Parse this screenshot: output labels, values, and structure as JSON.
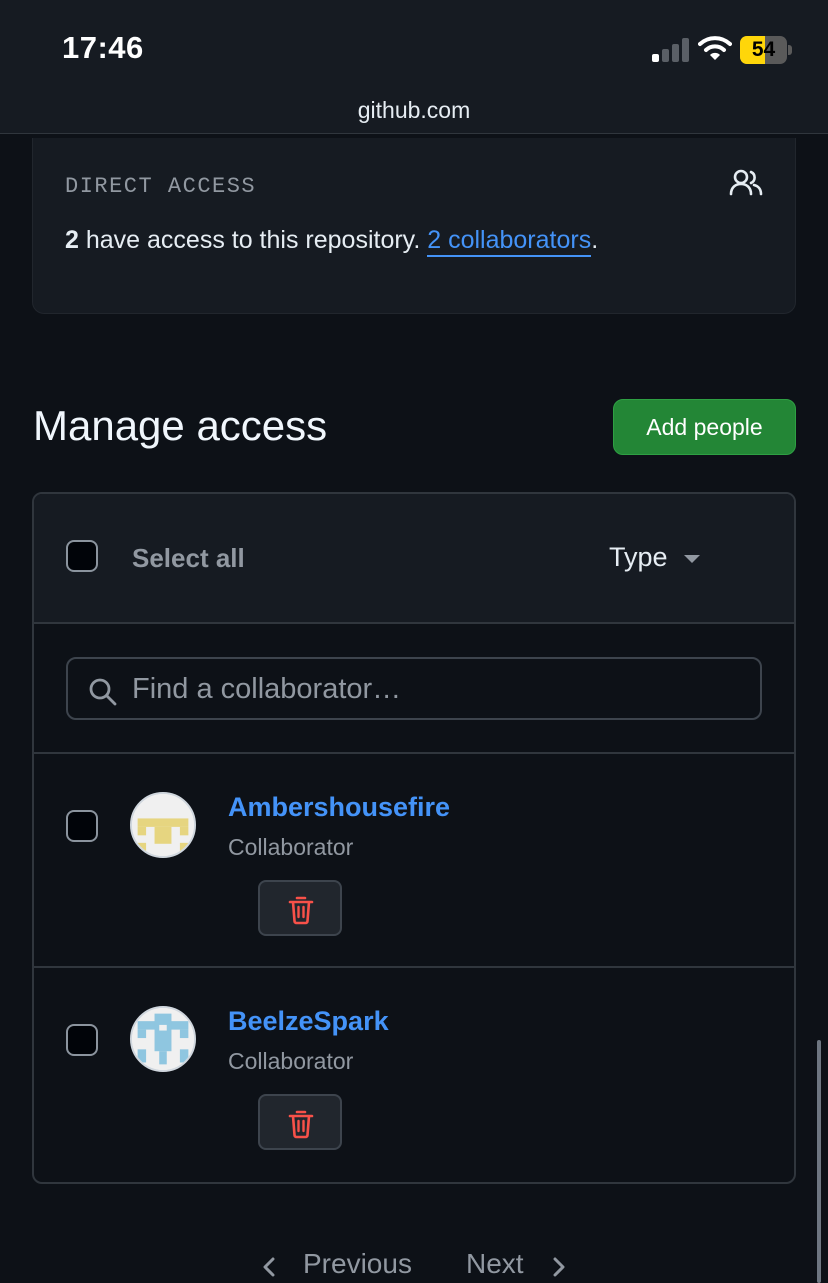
{
  "status_bar": {
    "time": "17:46",
    "battery_level": "54",
    "signal_bars_active": 1,
    "signal_bars_total": 4,
    "icons": [
      "cellular-signal-icon",
      "wifi-icon",
      "battery-icon"
    ]
  },
  "browser": {
    "url": "github.com"
  },
  "direct_access": {
    "title": "DIRECT ACCESS",
    "count": "2",
    "text": " have access to this repository. ",
    "link": "2 collaborators",
    "period": ".",
    "icon": "people-icon"
  },
  "manage": {
    "title": "Manage access",
    "add_button": "Add people",
    "select_all": "Select all",
    "type_filter": "Type",
    "search_placeholder": "Find a collaborator…"
  },
  "collaborators": [
    {
      "name": "Ambershousefire",
      "role": "Collaborator",
      "avatar_color": "#e6d580"
    },
    {
      "name": "BeelzeSpark",
      "role": "Collaborator",
      "avatar_color": "#8fc6e0"
    }
  ],
  "pagination": {
    "previous": "Previous",
    "next": "Next"
  },
  "colors": {
    "background": "#0d1117",
    "surface": "#161b22",
    "link": "#4493f8",
    "primary_button": "#238636",
    "danger": "#f85149"
  }
}
